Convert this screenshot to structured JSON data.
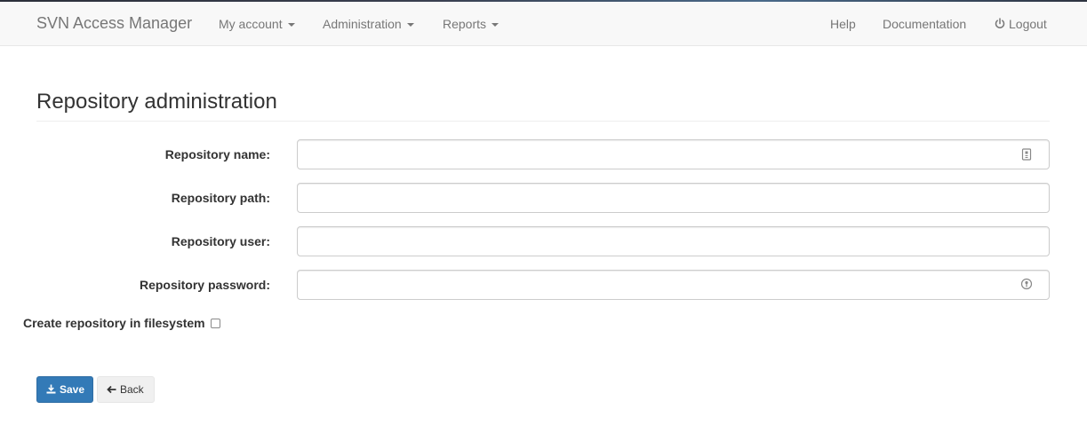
{
  "navbar": {
    "brand": "SVN Access Manager",
    "menus": [
      {
        "label": "My account"
      },
      {
        "label": "Administration"
      },
      {
        "label": "Reports"
      }
    ],
    "right_links": {
      "help": "Help",
      "documentation": "Documentation",
      "logout": "Logout"
    }
  },
  "page": {
    "title": "Repository administration"
  },
  "form": {
    "fields": [
      {
        "label": "Repository name:",
        "value": "",
        "icon": "contact-card-icon"
      },
      {
        "label": "Repository path:",
        "value": ""
      },
      {
        "label": "Repository user:",
        "value": ""
      },
      {
        "label": "Repository password:",
        "value": "",
        "icon": "key-icon"
      }
    ],
    "create_in_filesystem": {
      "label": "Create repository in filesystem",
      "checked": false
    }
  },
  "buttons": {
    "save": "Save",
    "back": "Back"
  },
  "colors": {
    "primary": "#337ab7",
    "navbar_bg": "#f8f8f8",
    "nav_text": "#777777"
  }
}
